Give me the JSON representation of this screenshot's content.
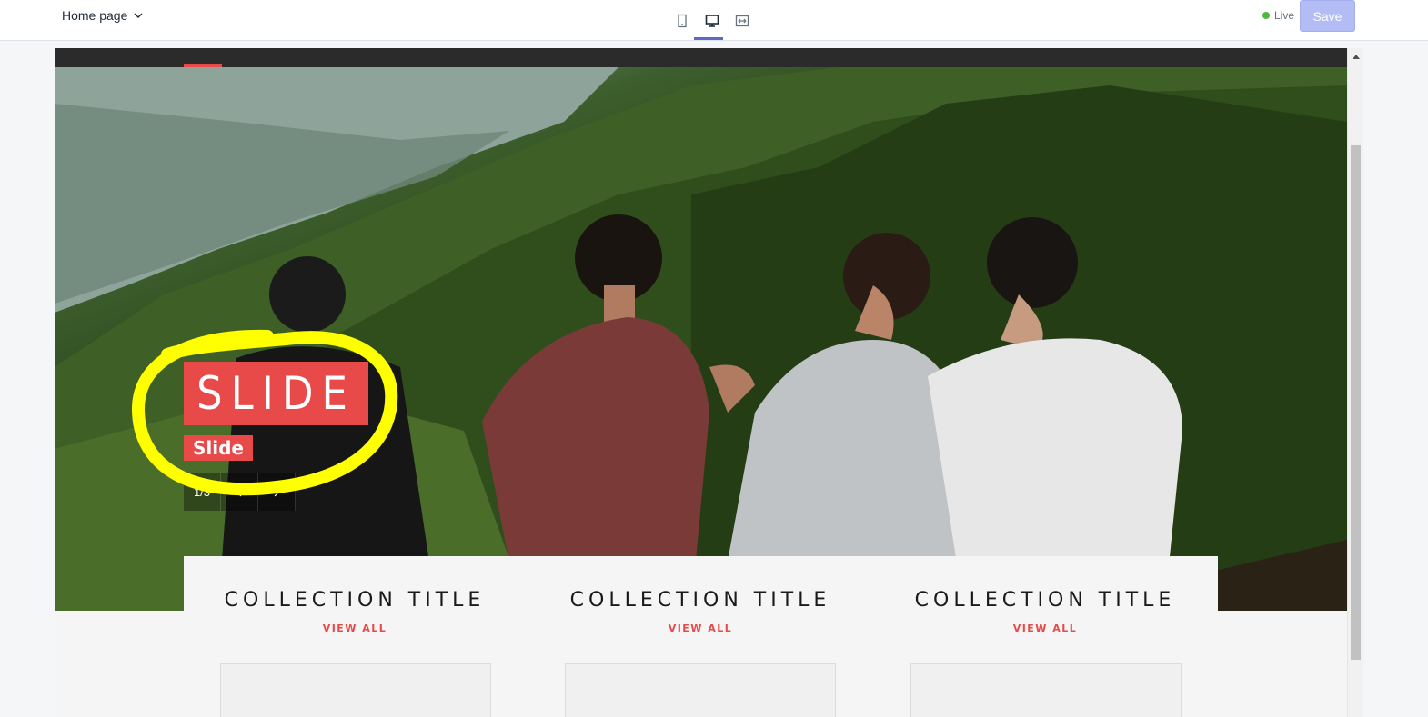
{
  "topbar": {
    "page_select_label": "Home page",
    "live_label": "Live",
    "save_label": "Save",
    "colors": {
      "accent": "#5c6ac4",
      "live": "#50b83c",
      "save_disabled": "#b3bcf5"
    }
  },
  "hero": {
    "slide_title": "SLIDE",
    "slide_subtitle": "Slide",
    "slide_counter": "1/3"
  },
  "collections": [
    {
      "title": "COLLECTION TITLE",
      "link": "VIEW ALL"
    },
    {
      "title": "COLLECTION TITLE",
      "link": "VIEW ALL"
    },
    {
      "title": "COLLECTION TITLE",
      "link": "VIEW ALL"
    }
  ],
  "theme": {
    "brand_red": "#e84a4a",
    "highlight": "#ffff00"
  }
}
